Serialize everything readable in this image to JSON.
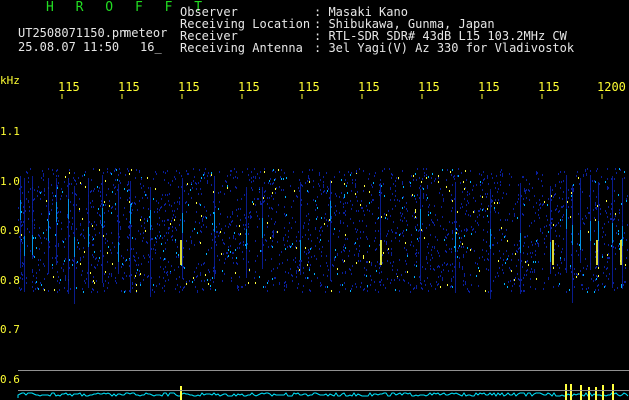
{
  "app": {
    "name": "H R O F F T",
    "file_name": "UT2508071150.pn",
    "mode": "meteor",
    "datetime": "25.08.07 11:50",
    "count": "16_"
  },
  "info": {
    "labels": [
      "Observer",
      "Receiving Location",
      "Receiver",
      "Receiving Antenna"
    ],
    "values": [
      ": Masaki Kano",
      ": Shibukawa, Gunma, Japan",
      ": RTL-SDR SDR# 43dB L15 103.2MHz CW",
      ": 3el Yagi(V) Az 330 for Vladivostok"
    ]
  },
  "axis": {
    "y_unit": "kHz",
    "y_ticks": [
      "1.1",
      "1.0",
      "0.9",
      "0.8",
      "0.7",
      "0.6"
    ],
    "x_ticks": [
      "115",
      "115",
      "115",
      "115",
      "115",
      "115",
      "115",
      "115",
      "115",
      "1200"
    ]
  },
  "colors": {
    "background": "#000000",
    "text": "#e6e6e6",
    "axis": "#ffff33",
    "title": "#22dd22",
    "spectrum_low": "#0a1f9c",
    "spectrum_mid": "#00b0ff",
    "spectrum_high": "#ffff40",
    "power_trace": "#00e5ff"
  }
}
